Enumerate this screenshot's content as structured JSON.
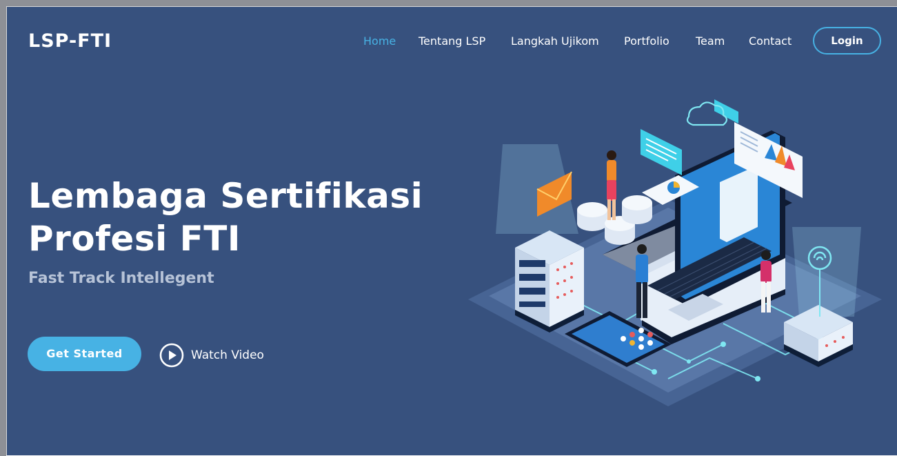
{
  "header": {
    "logo": "LSP-FTI",
    "nav": [
      {
        "label": "Home",
        "active": true
      },
      {
        "label": "Tentang LSP",
        "active": false
      },
      {
        "label": "Langkah Ujikom",
        "active": false
      },
      {
        "label": "Portfolio",
        "active": false
      },
      {
        "label": "Team",
        "active": false
      },
      {
        "label": "Contact",
        "active": false
      }
    ],
    "login_label": "Login"
  },
  "hero": {
    "title_line1": "Lembaga Sertifikasi",
    "title_line2": "Profesi FTI",
    "subtitle": "Fast Track Intellegent",
    "cta_label": "Get Started",
    "video_label": "Watch Video"
  },
  "colors": {
    "background": "#37517e",
    "accent": "#47b2e4",
    "text": "#ffffff"
  },
  "icons": {
    "play": "play-circle-icon",
    "illustration": "isometric-laptop-server-illustration"
  }
}
